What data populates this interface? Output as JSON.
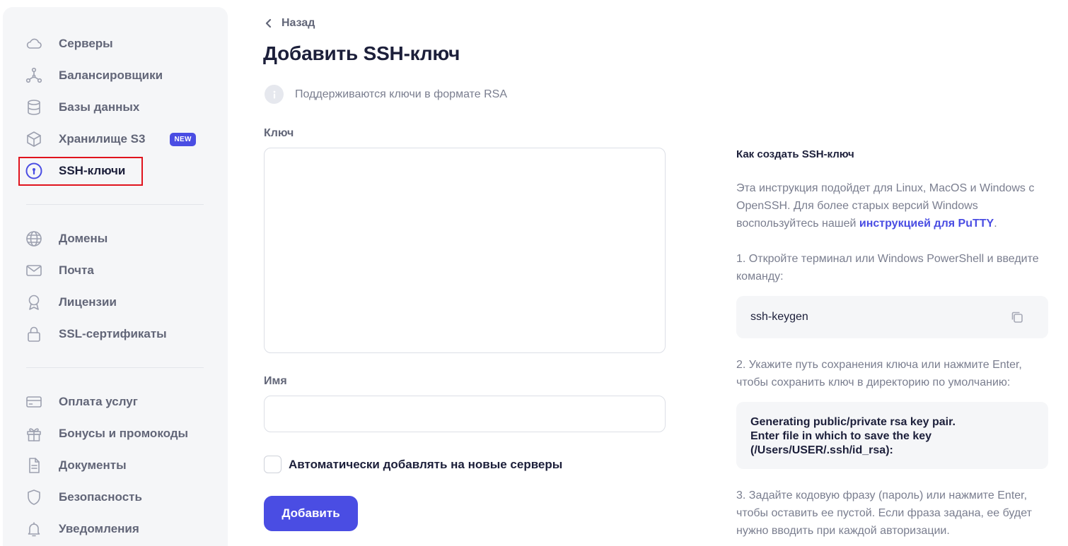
{
  "sidebar": {
    "items": [
      {
        "label": "Серверы",
        "icon": "cloud-icon"
      },
      {
        "label": "Балансировщики",
        "icon": "balancer-icon"
      },
      {
        "label": "Базы данных",
        "icon": "database-icon"
      },
      {
        "label": "Хранилище S3",
        "icon": "box-icon",
        "badge": "NEW"
      },
      {
        "label": "SSH-ключи",
        "icon": "key-icon",
        "active": true
      },
      {
        "label": "Домены",
        "icon": "globe-icon"
      },
      {
        "label": "Почта",
        "icon": "mail-icon"
      },
      {
        "label": "Лицензии",
        "icon": "award-icon"
      },
      {
        "label": "SSL-сертификаты",
        "icon": "lock-icon"
      },
      {
        "label": "Оплата услуг",
        "icon": "card-icon"
      },
      {
        "label": "Бонусы и промокоды",
        "icon": "gift-icon"
      },
      {
        "label": "Документы",
        "icon": "document-icon"
      },
      {
        "label": "Безопасность",
        "icon": "shield-icon"
      },
      {
        "label": "Уведомления",
        "icon": "bell-icon"
      }
    ]
  },
  "main": {
    "back_label": "Назад",
    "title": "Добавить SSH-ключ",
    "info_text": "Поддерживаются ключи в формате RSA",
    "key_label": "Ключ",
    "key_value": "",
    "name_label": "Имя",
    "name_value": "",
    "auto_add_label": "Автоматически добавлять на новые серверы",
    "auto_add_checked": false,
    "submit_label": "Добавить"
  },
  "instructions": {
    "title": "Как создать SSH-ключ",
    "intro_text": "Эта инструкция подойдет для Linux, MacOS и Windows с OpenSSH. Для более старых версий Windows воспользуйтесь нашей ",
    "intro_link": "инструкцией для PuTTY",
    "intro_end": ".",
    "step1": "1. Откройте терминал или Windows PowerShell и введите команду:",
    "command1": "ssh-keygen",
    "step2": "2. Укажите путь сохранения ключа или нажмите Enter, чтобы сохранить ключ в директорию по умолчанию:",
    "output_line1": "Generating public/private rsa key pair.",
    "output_line2": "Enter file in which to save the key",
    "output_line3": "(/Users/USER/.ssh/id_rsa):",
    "step3": "3. Задайте кодовую фразу (пароль) или нажмите Enter, чтобы оставить ее пустой. Если фраза задана, ее будет нужно вводить при каждой авторизации."
  },
  "colors": {
    "accent": "#4a4de3",
    "highlight_border": "#e0141e",
    "sidebar_bg": "#f5f6f8"
  }
}
